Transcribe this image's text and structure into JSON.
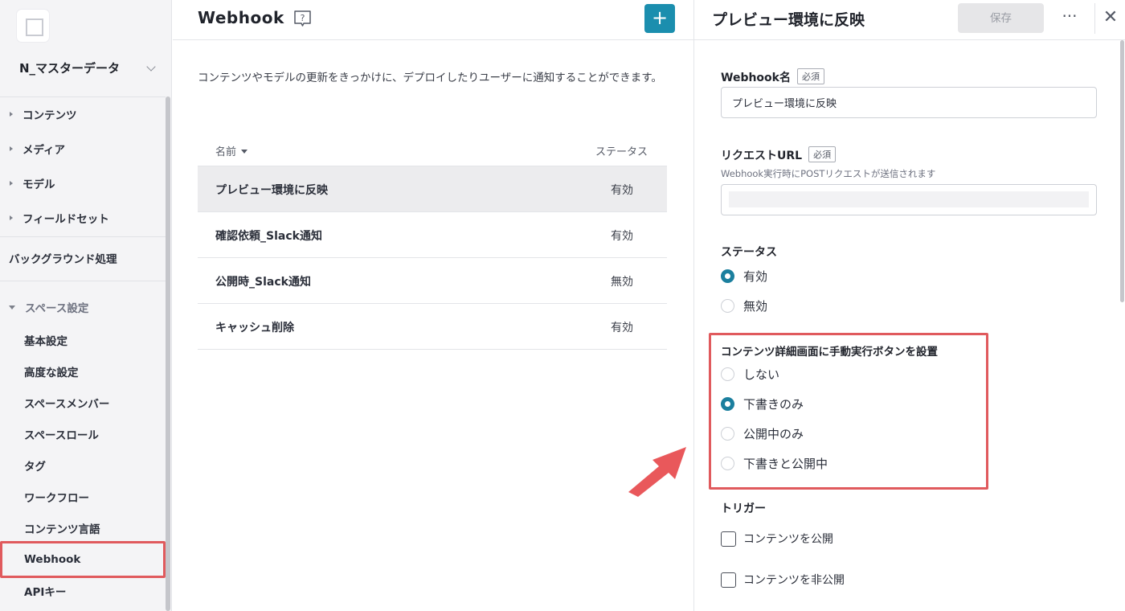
{
  "sidebar": {
    "space_name": "N_マスターデータ",
    "items": [
      {
        "label": "コンテンツ"
      },
      {
        "label": "メディア"
      },
      {
        "label": "モデル"
      },
      {
        "label": "フィールドセット"
      }
    ],
    "background_label": "バックグラウンド処理",
    "settings_section": "スペース設定",
    "settings_items": [
      {
        "label": "基本設定"
      },
      {
        "label": "高度な設定"
      },
      {
        "label": "スペースメンバー"
      },
      {
        "label": "スペースロール"
      },
      {
        "label": "タグ"
      },
      {
        "label": "ワークフロー"
      },
      {
        "label": "コンテンツ言語"
      },
      {
        "label": "Webhook"
      },
      {
        "label": "APIキー"
      }
    ]
  },
  "main": {
    "title": "Webhook",
    "add_label": "+",
    "description": "コンテンツやモデルの更新をきっかけに、デプロイしたりユーザーに通知することができます。",
    "columns": {
      "name": "名前",
      "status": "ステータス"
    },
    "rows": [
      {
        "name": "プレビュー環境に反映",
        "status": "有効"
      },
      {
        "name": "確認依頼_Slack通知",
        "status": "有効"
      },
      {
        "name": "公開時_Slack通知",
        "status": "無効"
      },
      {
        "name": "キャッシュ削除",
        "status": "有効"
      }
    ]
  },
  "panel": {
    "title": "プレビュー環境に反映",
    "save_label": "保存",
    "required_label": "必須",
    "webhook_name": {
      "label": "Webhook名",
      "value": "プレビュー環境に反映"
    },
    "request_url": {
      "label": "リクエストURL",
      "help": "Webhook実行時にPOSTリクエストが送信されます",
      "value": ""
    },
    "status": {
      "label": "ステータス",
      "options": [
        {
          "label": "有効",
          "selected": true
        },
        {
          "label": "無効",
          "selected": false
        }
      ]
    },
    "manual_button": {
      "label": "コンテンツ詳細画面に手動実行ボタンを設置",
      "options": [
        {
          "label": "しない",
          "selected": false
        },
        {
          "label": "下書きのみ",
          "selected": true
        },
        {
          "label": "公開中のみ",
          "selected": false
        },
        {
          "label": "下書きと公開中",
          "selected": false
        }
      ]
    },
    "trigger": {
      "label": "トリガー",
      "options": [
        {
          "label": "コンテンツを公開",
          "checked": false
        },
        {
          "label": "コンテンツを非公開",
          "checked": false
        }
      ]
    }
  },
  "colors": {
    "accent": "#1b8eae",
    "highlight": "#e05a5d",
    "sidebar_bg": "#f4f4f6"
  }
}
